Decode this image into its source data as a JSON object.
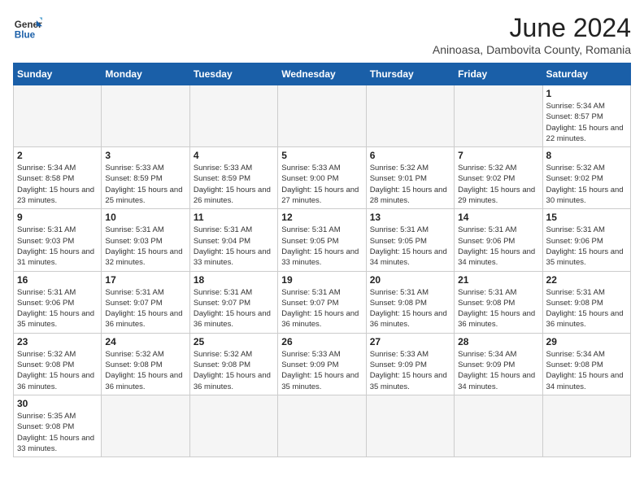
{
  "logo": {
    "text_general": "General",
    "text_blue": "Blue"
  },
  "header": {
    "month_year": "June 2024",
    "location": "Aninoasa, Dambovita County, Romania"
  },
  "weekdays": [
    "Sunday",
    "Monday",
    "Tuesday",
    "Wednesday",
    "Thursday",
    "Friday",
    "Saturday"
  ],
  "days": [
    {
      "num": "",
      "info": ""
    },
    {
      "num": "",
      "info": ""
    },
    {
      "num": "",
      "info": ""
    },
    {
      "num": "",
      "info": ""
    },
    {
      "num": "",
      "info": ""
    },
    {
      "num": "",
      "info": ""
    },
    {
      "num": "1",
      "info": "Sunrise: 5:34 AM\nSunset: 8:57 PM\nDaylight: 15 hours and 22 minutes."
    },
    {
      "num": "2",
      "info": "Sunrise: 5:34 AM\nSunset: 8:58 PM\nDaylight: 15 hours and 23 minutes."
    },
    {
      "num": "3",
      "info": "Sunrise: 5:33 AM\nSunset: 8:59 PM\nDaylight: 15 hours and 25 minutes."
    },
    {
      "num": "4",
      "info": "Sunrise: 5:33 AM\nSunset: 8:59 PM\nDaylight: 15 hours and 26 minutes."
    },
    {
      "num": "5",
      "info": "Sunrise: 5:33 AM\nSunset: 9:00 PM\nDaylight: 15 hours and 27 minutes."
    },
    {
      "num": "6",
      "info": "Sunrise: 5:32 AM\nSunset: 9:01 PM\nDaylight: 15 hours and 28 minutes."
    },
    {
      "num": "7",
      "info": "Sunrise: 5:32 AM\nSunset: 9:02 PM\nDaylight: 15 hours and 29 minutes."
    },
    {
      "num": "8",
      "info": "Sunrise: 5:32 AM\nSunset: 9:02 PM\nDaylight: 15 hours and 30 minutes."
    },
    {
      "num": "9",
      "info": "Sunrise: 5:31 AM\nSunset: 9:03 PM\nDaylight: 15 hours and 31 minutes."
    },
    {
      "num": "10",
      "info": "Sunrise: 5:31 AM\nSunset: 9:03 PM\nDaylight: 15 hours and 32 minutes."
    },
    {
      "num": "11",
      "info": "Sunrise: 5:31 AM\nSunset: 9:04 PM\nDaylight: 15 hours and 33 minutes."
    },
    {
      "num": "12",
      "info": "Sunrise: 5:31 AM\nSunset: 9:05 PM\nDaylight: 15 hours and 33 minutes."
    },
    {
      "num": "13",
      "info": "Sunrise: 5:31 AM\nSunset: 9:05 PM\nDaylight: 15 hours and 34 minutes."
    },
    {
      "num": "14",
      "info": "Sunrise: 5:31 AM\nSunset: 9:06 PM\nDaylight: 15 hours and 34 minutes."
    },
    {
      "num": "15",
      "info": "Sunrise: 5:31 AM\nSunset: 9:06 PM\nDaylight: 15 hours and 35 minutes."
    },
    {
      "num": "16",
      "info": "Sunrise: 5:31 AM\nSunset: 9:06 PM\nDaylight: 15 hours and 35 minutes."
    },
    {
      "num": "17",
      "info": "Sunrise: 5:31 AM\nSunset: 9:07 PM\nDaylight: 15 hours and 36 minutes."
    },
    {
      "num": "18",
      "info": "Sunrise: 5:31 AM\nSunset: 9:07 PM\nDaylight: 15 hours and 36 minutes."
    },
    {
      "num": "19",
      "info": "Sunrise: 5:31 AM\nSunset: 9:07 PM\nDaylight: 15 hours and 36 minutes."
    },
    {
      "num": "20",
      "info": "Sunrise: 5:31 AM\nSunset: 9:08 PM\nDaylight: 15 hours and 36 minutes."
    },
    {
      "num": "21",
      "info": "Sunrise: 5:31 AM\nSunset: 9:08 PM\nDaylight: 15 hours and 36 minutes."
    },
    {
      "num": "22",
      "info": "Sunrise: 5:31 AM\nSunset: 9:08 PM\nDaylight: 15 hours and 36 minutes."
    },
    {
      "num": "23",
      "info": "Sunrise: 5:32 AM\nSunset: 9:08 PM\nDaylight: 15 hours and 36 minutes."
    },
    {
      "num": "24",
      "info": "Sunrise: 5:32 AM\nSunset: 9:08 PM\nDaylight: 15 hours and 36 minutes."
    },
    {
      "num": "25",
      "info": "Sunrise: 5:32 AM\nSunset: 9:08 PM\nDaylight: 15 hours and 36 minutes."
    },
    {
      "num": "26",
      "info": "Sunrise: 5:33 AM\nSunset: 9:09 PM\nDaylight: 15 hours and 35 minutes."
    },
    {
      "num": "27",
      "info": "Sunrise: 5:33 AM\nSunset: 9:09 PM\nDaylight: 15 hours and 35 minutes."
    },
    {
      "num": "28",
      "info": "Sunrise: 5:34 AM\nSunset: 9:09 PM\nDaylight: 15 hours and 34 minutes."
    },
    {
      "num": "29",
      "info": "Sunrise: 5:34 AM\nSunset: 9:08 PM\nDaylight: 15 hours and 34 minutes."
    },
    {
      "num": "30",
      "info": "Sunrise: 5:35 AM\nSunset: 9:08 PM\nDaylight: 15 hours and 33 minutes."
    },
    {
      "num": "",
      "info": ""
    },
    {
      "num": "",
      "info": ""
    },
    {
      "num": "",
      "info": ""
    },
    {
      "num": "",
      "info": ""
    },
    {
      "num": "",
      "info": ""
    },
    {
      "num": "",
      "info": ""
    }
  ]
}
